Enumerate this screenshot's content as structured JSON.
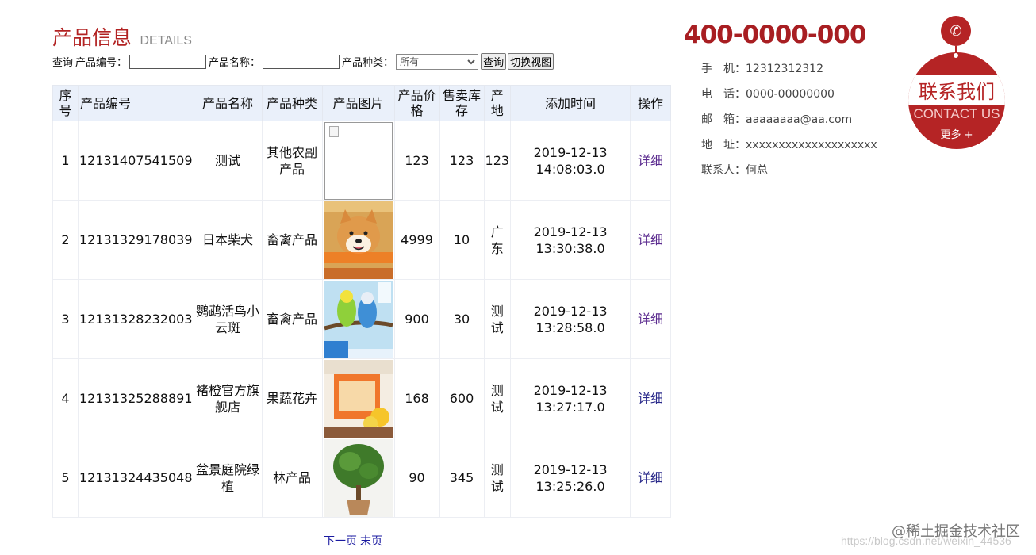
{
  "header": {
    "title": "产品信息",
    "subtitle": "DETAILS"
  },
  "search": {
    "query_label": "查询",
    "code_label": "产品编号：",
    "code_value": "",
    "name_label": "产品名称：",
    "name_value": "",
    "category_label": "产品种类：",
    "category_selected": "所有",
    "query_button": "查询",
    "switch_view_button": "切换视图"
  },
  "table": {
    "headers": [
      "序号",
      "产品编号",
      "产品名称",
      "产品种类",
      "产品图片",
      "产品价格",
      "售卖库存",
      "产地",
      "添加时间",
      "操作"
    ],
    "rows": [
      {
        "no": "1",
        "code": "12131407541509",
        "name": "测试",
        "category": "其他农副产品",
        "image": "broken-image",
        "price": "123",
        "stock": "123",
        "origin": "123",
        "date": "2019-12-13",
        "time": "14:08:03.0",
        "action": "详细"
      },
      {
        "no": "2",
        "code": "12131329178039",
        "name": "日本柴犬",
        "category": "畜禽产品",
        "image": "shiba-dog-photo",
        "price": "4999",
        "stock": "10",
        "origin": "广东",
        "date": "2019-12-13",
        "time": "13:30:38.0",
        "action": "详细"
      },
      {
        "no": "3",
        "code": "12131328232003",
        "name": "鹦鹉活鸟小云斑",
        "category": "畜禽产品",
        "image": "parrot-photo",
        "price": "900",
        "stock": "30",
        "origin": "测试",
        "date": "2019-12-13",
        "time": "13:28:58.0",
        "action": "详细"
      },
      {
        "no": "4",
        "code": "12131325288891",
        "name": "褚橙官方旗舰店",
        "category": "果蔬花卉",
        "image": "orange-box-photo",
        "price": "168",
        "stock": "600",
        "origin": "测试",
        "date": "2019-12-13",
        "time": "13:27:17.0",
        "action": "详细"
      },
      {
        "no": "5",
        "code": "12131324435048",
        "name": "盆景庭院绿植",
        "category": "林产品",
        "image": "bonsai-photo",
        "price": "90",
        "stock": "345",
        "origin": "测试",
        "date": "2019-12-13",
        "time": "13:25:26.0",
        "action": "详细"
      }
    ]
  },
  "pager": {
    "next": "下一页",
    "last": "末页"
  },
  "contact": {
    "phone": "400-0000-000",
    "mobile_label": "手　机：",
    "mobile": "12312312312",
    "tel_label": "电　话：",
    "tel": "0000-00000000",
    "email_label": "邮　箱：",
    "email": "aaaaaaaa@aa.com",
    "address_label": "地　址：",
    "address": "xxxxxxxxxxxxxxxxxxxx",
    "person_label": "联系人：",
    "person": "何总"
  },
  "badge": {
    "cn": "联系我们",
    "en": "CONTACT US",
    "more": "更多 +",
    "icon": "phone-icon"
  },
  "watermark": {
    "text": "@稀土掘金技术社区",
    "url_text": "https://blog.csdn.net/weixin_44536"
  },
  "colors": {
    "accent": "#b22222",
    "header_bg": "#eaf0fa",
    "link": "#1a1aa0"
  }
}
